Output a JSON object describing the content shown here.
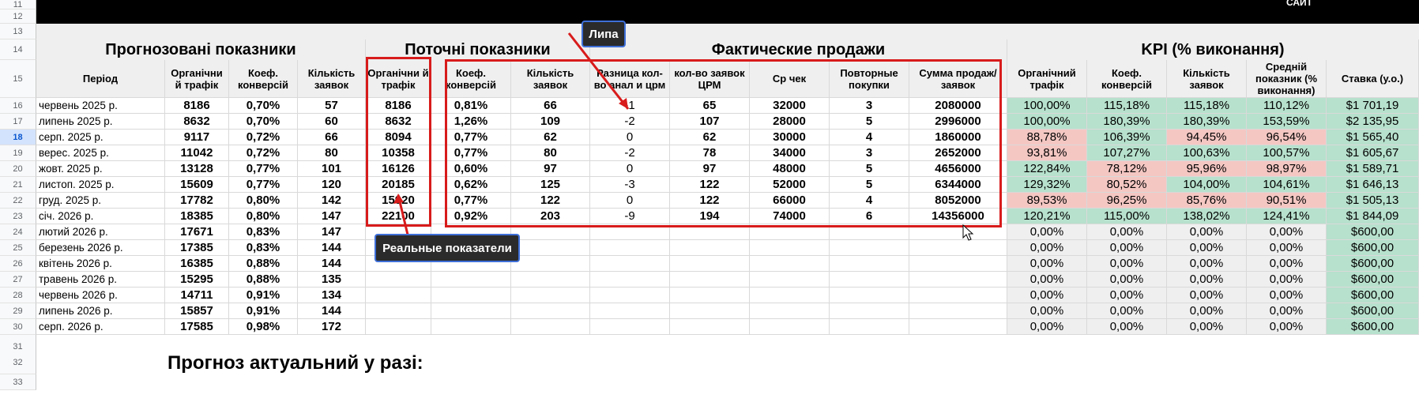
{
  "top_bar": {
    "label": "САЙТ"
  },
  "row_numbers": [
    "11",
    "12",
    "13",
    "14",
    "15",
    "16",
    "17",
    "18",
    "19",
    "20",
    "21",
    "22",
    "23",
    "24",
    "25",
    "26",
    "27",
    "28",
    "29",
    "30",
    "31",
    "32",
    "33"
  ],
  "selected_row": "18",
  "groups": {
    "forecast": "Прогнозовані показники",
    "current": "Поточні показники",
    "actual": "Фактические продажи",
    "kpi": "KPI (% виконання)"
  },
  "headers": [
    "Період",
    "Органічни й трафік",
    "Коеф. конверсій",
    "Кількість заявок",
    "Органічни й трафік",
    "Коеф. конверсій",
    "Кількість заявок",
    "Разница кол-во анал и црм",
    "кол-во заявок ЦРМ",
    "Ср чек",
    "Повторные покупки",
    "Сумма продаж/заявок",
    "Органічний трафік",
    "Коеф. конверсій",
    "Кількість заявок",
    "Средній показник (% виконання)",
    "Ставка (у.о.)"
  ],
  "rows": [
    {
      "period": "червень 2025 р.",
      "f_traffic": "8186",
      "f_conv": "0,70%",
      "f_leads": "57",
      "c_traffic": "8186",
      "c_conv": "0,81%",
      "c_leads": "66",
      "diff": "-1",
      "crm": "65",
      "avg": "32000",
      "repeat": "3",
      "sum": "2080000",
      "k_traffic": "100,00%",
      "k_conv": "115,18%",
      "k_leads": "115,18%",
      "k_avg": "110,12%",
      "rate": "$1 701,19",
      "colors": [
        "green",
        "green",
        "green",
        "green"
      ]
    },
    {
      "period": "липень 2025 р.",
      "f_traffic": "8632",
      "f_conv": "0,70%",
      "f_leads": "60",
      "c_traffic": "8632",
      "c_conv": "1,26%",
      "c_leads": "109",
      "diff": "-2",
      "crm": "107",
      "avg": "28000",
      "repeat": "5",
      "sum": "2996000",
      "k_traffic": "100,00%",
      "k_conv": "180,39%",
      "k_leads": "180,39%",
      "k_avg": "153,59%",
      "rate": "$2 135,95",
      "colors": [
        "green",
        "green",
        "green",
        "green"
      ]
    },
    {
      "period": "серп. 2025 р.",
      "f_traffic": "9117",
      "f_conv": "0,72%",
      "f_leads": "66",
      "c_traffic": "8094",
      "c_conv": "0,77%",
      "c_leads": "62",
      "diff": "0",
      "crm": "62",
      "avg": "30000",
      "repeat": "4",
      "sum": "1860000",
      "k_traffic": "88,78%",
      "k_conv": "106,39%",
      "k_leads": "94,45%",
      "k_avg": "96,54%",
      "rate": "$1 565,40",
      "colors": [
        "red",
        "green",
        "red",
        "red"
      ]
    },
    {
      "period": "верес. 2025 р.",
      "f_traffic": "11042",
      "f_conv": "0,72%",
      "f_leads": "80",
      "c_traffic": "10358",
      "c_conv": "0,77%",
      "c_leads": "80",
      "diff": "-2",
      "crm": "78",
      "avg": "34000",
      "repeat": "3",
      "sum": "2652000",
      "k_traffic": "93,81%",
      "k_conv": "107,27%",
      "k_leads": "100,63%",
      "k_avg": "100,57%",
      "rate": "$1 605,67",
      "colors": [
        "red",
        "green",
        "green",
        "green"
      ]
    },
    {
      "period": "жовт. 2025 р.",
      "f_traffic": "13128",
      "f_conv": "0,77%",
      "f_leads": "101",
      "c_traffic": "16126",
      "c_conv": "0,60%",
      "c_leads": "97",
      "diff": "0",
      "crm": "97",
      "avg": "48000",
      "repeat": "5",
      "sum": "4656000",
      "k_traffic": "122,84%",
      "k_conv": "78,12%",
      "k_leads": "95,96%",
      "k_avg": "98,97%",
      "rate": "$1 589,71",
      "colors": [
        "green",
        "red",
        "red",
        "red"
      ]
    },
    {
      "period": "листоп. 2025 р.",
      "f_traffic": "15609",
      "f_conv": "0,77%",
      "f_leads": "120",
      "c_traffic": "20185",
      "c_conv": "0,62%",
      "c_leads": "125",
      "diff": "-3",
      "crm": "122",
      "avg": "52000",
      "repeat": "5",
      "sum": "6344000",
      "k_traffic": "129,32%",
      "k_conv": "80,52%",
      "k_leads": "104,00%",
      "k_avg": "104,61%",
      "rate": "$1 646,13",
      "colors": [
        "green",
        "red",
        "green",
        "green"
      ]
    },
    {
      "period": "груд. 2025 р.",
      "f_traffic": "17782",
      "f_conv": "0,80%",
      "f_leads": "142",
      "c_traffic": "15920",
      "c_conv": "0,77%",
      "c_leads": "122",
      "diff": "0",
      "crm": "122",
      "avg": "66000",
      "repeat": "4",
      "sum": "8052000",
      "k_traffic": "89,53%",
      "k_conv": "96,25%",
      "k_leads": "85,76%",
      "k_avg": "90,51%",
      "rate": "$1 505,13",
      "colors": [
        "red",
        "red",
        "red",
        "red"
      ]
    },
    {
      "period": "січ. 2026 р.",
      "f_traffic": "18385",
      "f_conv": "0,80%",
      "f_leads": "147",
      "c_traffic": "22100",
      "c_conv": "0,92%",
      "c_leads": "203",
      "diff": "-9",
      "crm": "194",
      "avg": "74000",
      "repeat": "6",
      "sum": "14356000",
      "k_traffic": "120,21%",
      "k_conv": "115,00%",
      "k_leads": "138,02%",
      "k_avg": "124,41%",
      "rate": "$1 844,09",
      "colors": [
        "green",
        "green",
        "green",
        "green"
      ]
    },
    {
      "period": "лютий 2026 р.",
      "f_traffic": "17671",
      "f_conv": "0,83%",
      "f_leads": "147",
      "c_traffic": "",
      "c_conv": "",
      "c_leads": "",
      "diff": "",
      "crm": "",
      "avg": "",
      "repeat": "",
      "sum": "",
      "k_traffic": "0,00%",
      "k_conv": "0,00%",
      "k_leads": "0,00%",
      "k_avg": "0,00%",
      "rate": "$600,00",
      "colors": [
        "gray",
        "gray",
        "gray",
        "gray"
      ]
    },
    {
      "period": "березень 2026 р.",
      "f_traffic": "17385",
      "f_conv": "0,83%",
      "f_leads": "144",
      "c_traffic": "",
      "c_conv": "",
      "c_leads": "",
      "diff": "",
      "crm": "",
      "avg": "",
      "repeat": "",
      "sum": "",
      "k_traffic": "0,00%",
      "k_conv": "0,00%",
      "k_leads": "0,00%",
      "k_avg": "0,00%",
      "rate": "$600,00",
      "colors": [
        "gray",
        "gray",
        "gray",
        "gray"
      ]
    },
    {
      "period": "квітень 2026 р.",
      "f_traffic": "16385",
      "f_conv": "0,88%",
      "f_leads": "144",
      "c_traffic": "",
      "c_conv": "",
      "c_leads": "",
      "diff": "",
      "crm": "",
      "avg": "",
      "repeat": "",
      "sum": "",
      "k_traffic": "0,00%",
      "k_conv": "0,00%",
      "k_leads": "0,00%",
      "k_avg": "0,00%",
      "rate": "$600,00",
      "colors": [
        "gray",
        "gray",
        "gray",
        "gray"
      ]
    },
    {
      "period": "травень 2026 р.",
      "f_traffic": "15295",
      "f_conv": "0,88%",
      "f_leads": "135",
      "c_traffic": "",
      "c_conv": "",
      "c_leads": "",
      "diff": "",
      "crm": "",
      "avg": "",
      "repeat": "",
      "sum": "",
      "k_traffic": "0,00%",
      "k_conv": "0,00%",
      "k_leads": "0,00%",
      "k_avg": "0,00%",
      "rate": "$600,00",
      "colors": [
        "gray",
        "gray",
        "gray",
        "gray"
      ]
    },
    {
      "period": "червень 2026 р.",
      "f_traffic": "14711",
      "f_conv": "0,91%",
      "f_leads": "134",
      "c_traffic": "",
      "c_conv": "",
      "c_leads": "",
      "diff": "",
      "crm": "",
      "avg": "",
      "repeat": "",
      "sum": "",
      "k_traffic": "0,00%",
      "k_conv": "0,00%",
      "k_leads": "0,00%",
      "k_avg": "0,00%",
      "rate": "$600,00",
      "colors": [
        "gray",
        "gray",
        "gray",
        "gray"
      ]
    },
    {
      "period": "липень 2026 р.",
      "f_traffic": "15857",
      "f_conv": "0,91%",
      "f_leads": "144",
      "c_traffic": "",
      "c_conv": "",
      "c_leads": "",
      "diff": "",
      "crm": "",
      "avg": "",
      "repeat": "",
      "sum": "",
      "k_traffic": "0,00%",
      "k_conv": "0,00%",
      "k_leads": "0,00%",
      "k_avg": "0,00%",
      "rate": "$600,00",
      "colors": [
        "gray",
        "gray",
        "gray",
        "gray"
      ]
    },
    {
      "period": "серп. 2026 р.",
      "f_traffic": "17585",
      "f_conv": "0,98%",
      "f_leads": "172",
      "c_traffic": "",
      "c_conv": "",
      "c_leads": "",
      "diff": "",
      "crm": "",
      "avg": "",
      "repeat": "",
      "sum": "",
      "k_traffic": "0,00%",
      "k_conv": "0,00%",
      "k_leads": "0,00%",
      "k_avg": "0,00%",
      "rate": "$600,00",
      "colors": [
        "gray",
        "gray",
        "gray",
        "gray"
      ]
    }
  ],
  "annotations": {
    "lipa": "Липа",
    "real": "Реальные показатели"
  },
  "bottom_title": "Прогноз актуальний у разі:"
}
